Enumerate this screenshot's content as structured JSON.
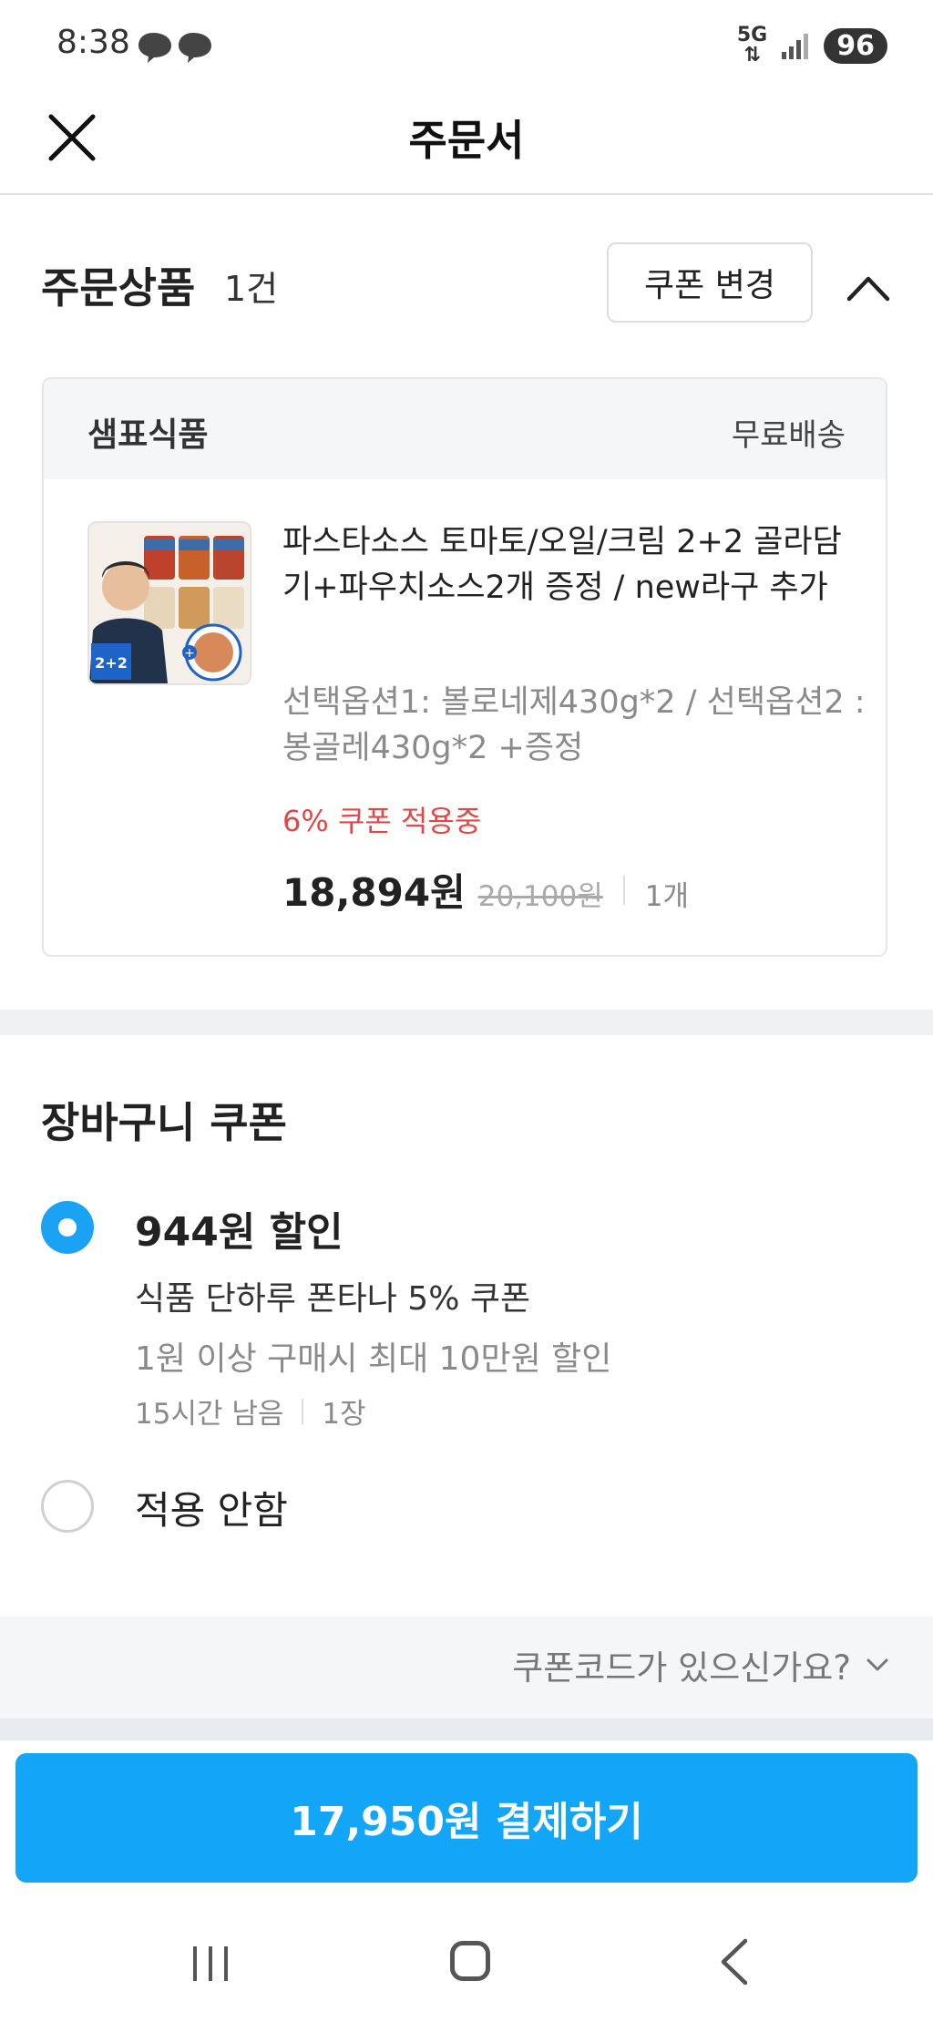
{
  "status_bar": {
    "time": "8:38",
    "network": "5G",
    "battery": "96"
  },
  "header": {
    "title": "주문서"
  },
  "order": {
    "title": "주문상품",
    "count": "1건",
    "coupon_change_label": "쿠폰 변경",
    "seller": "샘표식품",
    "shipping": "무료배송",
    "product_name": "파스타소스 토마토/오일/크림 2+2 골라담기+파우치소스2개 증정 / new라구 추가",
    "options": "선택옵션1: 볼로네제430g*2 / 선택옵션2 : 봉골레430g*2 +증정",
    "coupon_applied": "6% 쿠폰 적용중",
    "price": "18,894원",
    "original_price": "20,100원",
    "quantity": "1개",
    "thumb_badge": "2+2"
  },
  "cart_coupon": {
    "title": "장바구니 쿠폰",
    "option1": {
      "title": "944원 할인",
      "name": "식품 단하루 폰타나 5% 쿠폰",
      "condition": "1원 이상 구매시 최대 10만원 할인",
      "time_left": "15시간 남음",
      "count": "1장",
      "selected": true
    },
    "option2": {
      "label": "적용 안함",
      "selected": false
    },
    "code_link": "쿠폰코드가 있으신가요?"
  },
  "pay_button": "17,950원 결제하기",
  "colors": {
    "accent": "#12a5f8",
    "coupon_red": "#e04848"
  }
}
